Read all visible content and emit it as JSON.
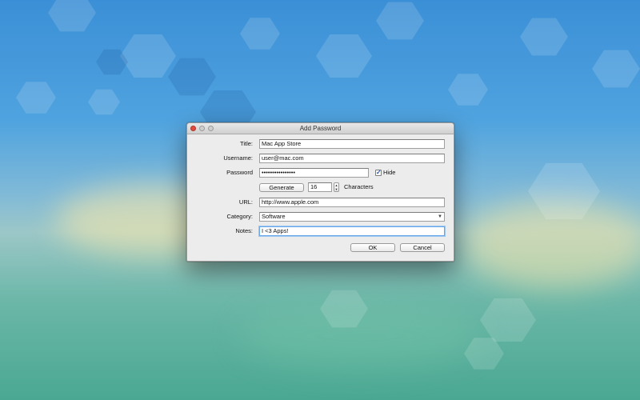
{
  "dialog": {
    "title": "Add Password",
    "labels": {
      "title": "Title:",
      "username": "Username:",
      "password": "Password",
      "url": "URL:",
      "category": "Category:",
      "notes": "Notes:"
    },
    "values": {
      "title": "Mac App Store",
      "username": "user@mac.com",
      "password": "••••••••••••••••",
      "length": "16",
      "url": "http://www.apple.com",
      "category": "Software",
      "notes": "I <3 Apps!"
    },
    "hide_label": "Hide",
    "hide_checked": true,
    "generate_label": "Generate",
    "characters_label": "Characters",
    "ok_label": "OK",
    "cancel_label": "Cancel"
  },
  "icons": {
    "close": "close-icon",
    "minimize": "minimize-icon",
    "zoom": "zoom-icon",
    "checkmark": "checkmark-icon",
    "dropdown": "chevron-down-icon",
    "stepper": "stepper-arrows-icon"
  },
  "colors": {
    "close": "#e44b3c",
    "focus_ring": "#6aa7e8",
    "checkmark": "#1b55b5"
  }
}
